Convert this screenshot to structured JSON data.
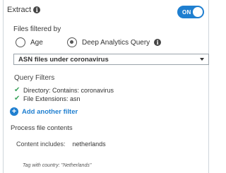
{
  "extract": {
    "label": "Extract",
    "toggle_label": "ON"
  },
  "files_filter": {
    "label": "Files filtered by",
    "options": [
      {
        "label": "Age",
        "selected": false
      },
      {
        "label": "Deep Analytics Query",
        "selected": true
      }
    ]
  },
  "query_select": {
    "value": "ASN files under coronavirus"
  },
  "query_filters": {
    "title": "Query Filters",
    "items": [
      {
        "text": "Directory: Contains: coronavirus"
      },
      {
        "text": "File Extensions: asn"
      }
    ]
  },
  "add_filter": {
    "label": "Add another filter"
  },
  "process": {
    "title": "Process file contents",
    "content_label": "Content includes:",
    "content_value": "netherlands",
    "tag_note": "Tag with country: \"Netherlands\""
  },
  "colors": {
    "accent": "#1f7fd0",
    "check": "#3aa35c"
  }
}
